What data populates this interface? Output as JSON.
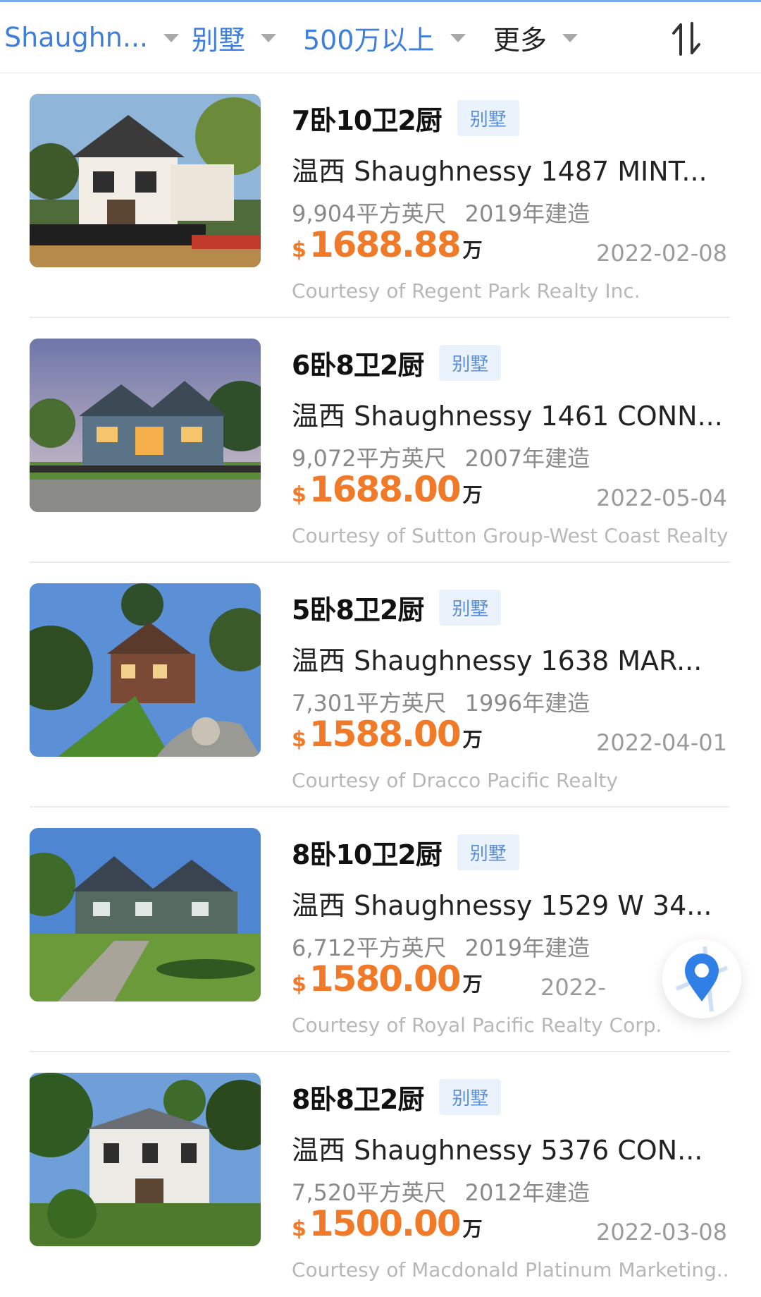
{
  "filters": [
    {
      "label": "Shaughn...",
      "active": true
    },
    {
      "label": "别墅",
      "active": true
    },
    {
      "label": "500万以上",
      "active": true
    },
    {
      "label": "更多",
      "active": false
    }
  ],
  "sort_icon": "sort-arrows-icon",
  "map_icon": "map-pin-icon",
  "currency_symbol": "$",
  "price_unit": "万",
  "colors": {
    "accent_blue": "#3f7fdc",
    "price_orange": "#f07a28",
    "tag_bg": "#eaf2fc",
    "tag_text": "#5d8fd6"
  },
  "listings": [
    {
      "rooms": "7卧10卫2厨",
      "type": "别墅",
      "address": "温西 Shaughnessy  1487 MINT...",
      "sqft": "9,904平方英尺",
      "built": "2019年建造",
      "price": "1688.88",
      "date": "2022-02-08",
      "courtesy": "Courtesy of Regent Park Realty Inc."
    },
    {
      "rooms": "6卧8卫2厨",
      "type": "别墅",
      "address": "温西 Shaughnessy  1461 CONN...",
      "sqft": "9,072平方英尺",
      "built": "2007年建造",
      "price": "1688.00",
      "date": "2022-05-04",
      "courtesy": "Courtesy of Sutton Group-West Coast Realty"
    },
    {
      "rooms": "5卧8卫2厨",
      "type": "别墅",
      "address": "温西 Shaughnessy  1638 MAR...",
      "sqft": "7,301平方英尺",
      "built": "1996年建造",
      "price": "1588.00",
      "date": "2022-04-01",
      "courtesy": "Courtesy of Dracco Pacific Realty"
    },
    {
      "rooms": "8卧10卫2厨",
      "type": "别墅",
      "address": "温西 Shaughnessy  1529 W 34...",
      "sqft": "6,712平方英尺",
      "built": "2019年建造",
      "price": "1580.00",
      "date": "2022-",
      "courtesy": "Courtesy of Royal Pacific Realty Corp."
    },
    {
      "rooms": "8卧8卫2厨",
      "type": "别墅",
      "address": "温西 Shaughnessy  5376 CON...",
      "sqft": "7,520平方英尺",
      "built": "2012年建造",
      "price": "1500.00",
      "date": "2022-03-08",
      "courtesy": "Courtesy of Macdonald Platinum Marketing..."
    }
  ]
}
